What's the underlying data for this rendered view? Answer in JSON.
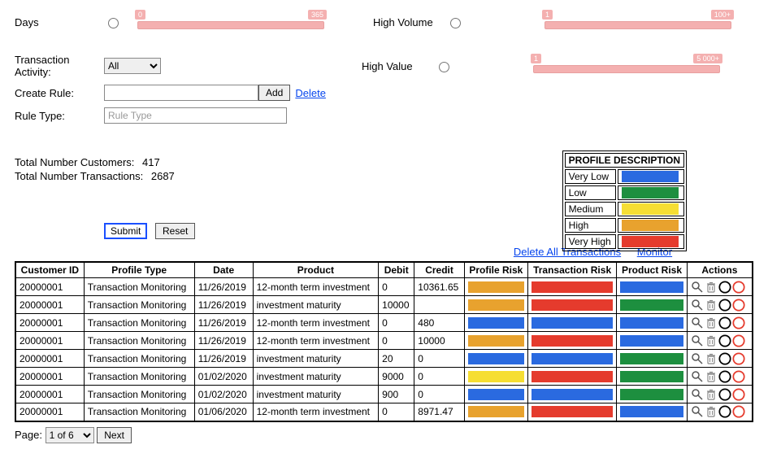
{
  "filters": {
    "days_label": "Days",
    "high_volume_label": "High Volume",
    "high_value_label": "High Value",
    "transaction_activity_label": "Transaction Activity:",
    "transaction_activity_selected": "All",
    "create_rule_label": "Create Rule:",
    "rule_type_label": "Rule Type:",
    "rule_type_placeholder": "Rule Type",
    "add_btn": "Add",
    "delete_link": "Delete",
    "days_min": "0",
    "days_max": "365",
    "hv_min": "1",
    "hv_max": "100+",
    "hval_min": "1",
    "hval_max": "5 000+"
  },
  "totals": {
    "cust_label": "Total Number Customers:",
    "cust_val": "417",
    "trans_label": "Total Number Transactions:",
    "trans_val": "2687"
  },
  "legend": {
    "title": "PROFILE DESCRIPTION",
    "rows": [
      {
        "label": "Very Low",
        "cls": "c-verylow"
      },
      {
        "label": "Low",
        "cls": "c-low"
      },
      {
        "label": "Medium",
        "cls": "c-medium"
      },
      {
        "label": "High",
        "cls": "c-high"
      },
      {
        "label": "Very High",
        "cls": "c-veryhigh"
      }
    ]
  },
  "buttons": {
    "submit": "Submit",
    "reset": "Reset"
  },
  "links": {
    "delete_all": "Delete All Transactions",
    "monitor": "Monitor"
  },
  "table": {
    "headers": [
      "Customer ID",
      "Profile Type",
      "Date",
      "Product",
      "Debit",
      "Credit",
      "Profile Risk",
      "Transaction Risk",
      "Product Risk",
      "Actions"
    ],
    "rows": [
      {
        "cid": "20000001",
        "ptype": "Transaction Monitoring",
        "date": "11/26/2019",
        "product": "12-month term investment",
        "debit": "0",
        "credit": "10361.65",
        "pr": "c-high",
        "tr": "c-veryhigh",
        "prodr": "c-verylow"
      },
      {
        "cid": "20000001",
        "ptype": "Transaction Monitoring",
        "date": "11/26/2019",
        "product": "investment maturity",
        "debit": "10000",
        "credit": " ",
        "pr": "c-high",
        "tr": "c-veryhigh",
        "prodr": "c-low"
      },
      {
        "cid": "20000001",
        "ptype": "Transaction Monitoring",
        "date": "11/26/2019",
        "product": "12-month term investment",
        "debit": "0",
        "credit": "480",
        "pr": "c-verylow",
        "tr": "c-verylow",
        "prodr": "c-verylow"
      },
      {
        "cid": "20000001",
        "ptype": "Transaction Monitoring",
        "date": "11/26/2019",
        "product": "12-month term investment",
        "debit": "0",
        "credit": "10000",
        "pr": "c-high",
        "tr": "c-veryhigh",
        "prodr": "c-verylow"
      },
      {
        "cid": "20000001",
        "ptype": "Transaction Monitoring",
        "date": "11/26/2019",
        "product": "investment maturity",
        "debit": "20",
        "credit": "0",
        "pr": "c-verylow",
        "tr": "c-verylow",
        "prodr": "c-low"
      },
      {
        "cid": "20000001",
        "ptype": "Transaction Monitoring",
        "date": "01/02/2020",
        "product": "investment maturity",
        "debit": "9000",
        "credit": "0",
        "pr": "c-medium",
        "tr": "c-veryhigh",
        "prodr": "c-low"
      },
      {
        "cid": "20000001",
        "ptype": "Transaction Monitoring",
        "date": "01/02/2020",
        "product": "investment maturity",
        "debit": "900",
        "credit": "0",
        "pr": "c-verylow",
        "tr": "c-verylow",
        "prodr": "c-low"
      },
      {
        "cid": "20000001",
        "ptype": "Transaction Monitoring",
        "date": "01/06/2020",
        "product": "12-month term investment",
        "debit": "0",
        "credit": "8971.47",
        "pr": "c-high",
        "tr": "c-veryhigh",
        "prodr": "c-verylow"
      }
    ]
  },
  "pager": {
    "page_label": "Page:",
    "current": "1 of 6",
    "next": "Next"
  }
}
